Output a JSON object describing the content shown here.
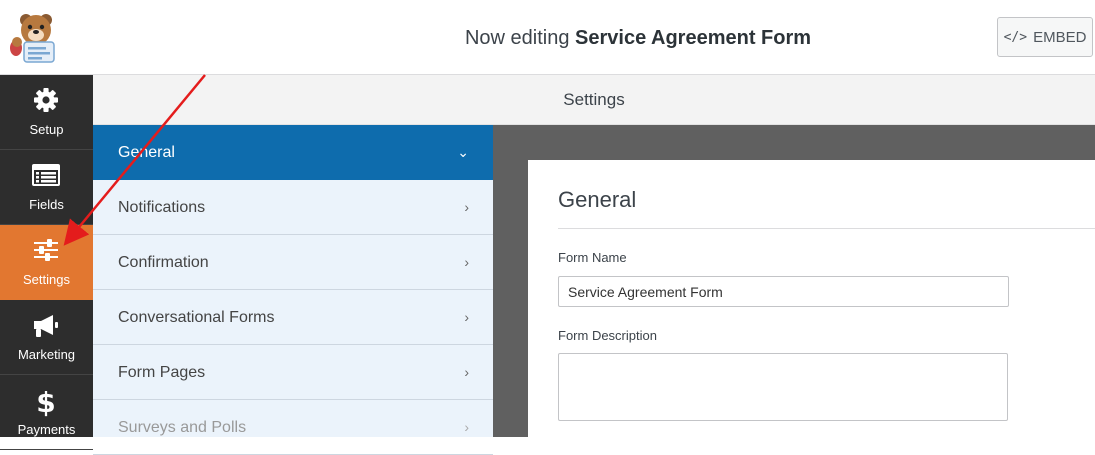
{
  "header": {
    "title_prefix": "Now editing",
    "form_name": "Service Agreement Form",
    "embed_label": "EMBED",
    "embed_icon": "</>"
  },
  "leftnav": {
    "items": [
      {
        "label": "Setup",
        "icon": "gear-icon"
      },
      {
        "label": "Fields",
        "icon": "list-icon"
      },
      {
        "label": "Settings",
        "icon": "sliders-icon",
        "active": true
      },
      {
        "label": "Marketing",
        "icon": "megaphone-icon"
      },
      {
        "label": "Payments",
        "icon": "dollar-icon"
      }
    ]
  },
  "settings": {
    "heading": "Settings",
    "menu": [
      {
        "label": "General",
        "active": true
      },
      {
        "label": "Notifications"
      },
      {
        "label": "Confirmation"
      },
      {
        "label": "Conversational Forms"
      },
      {
        "label": "Form Pages"
      },
      {
        "label": "Surveys and Polls",
        "disabled": true
      }
    ]
  },
  "general": {
    "title": "General",
    "form_name_label": "Form Name",
    "form_name_value": "Service Agreement Form",
    "form_description_label": "Form Description",
    "form_description_value": ""
  },
  "colors": {
    "accent_orange": "#e27730",
    "accent_blue": "#0e6cad",
    "nav_dark": "#2d2d2d",
    "annotation_red": "#e41c1c"
  }
}
